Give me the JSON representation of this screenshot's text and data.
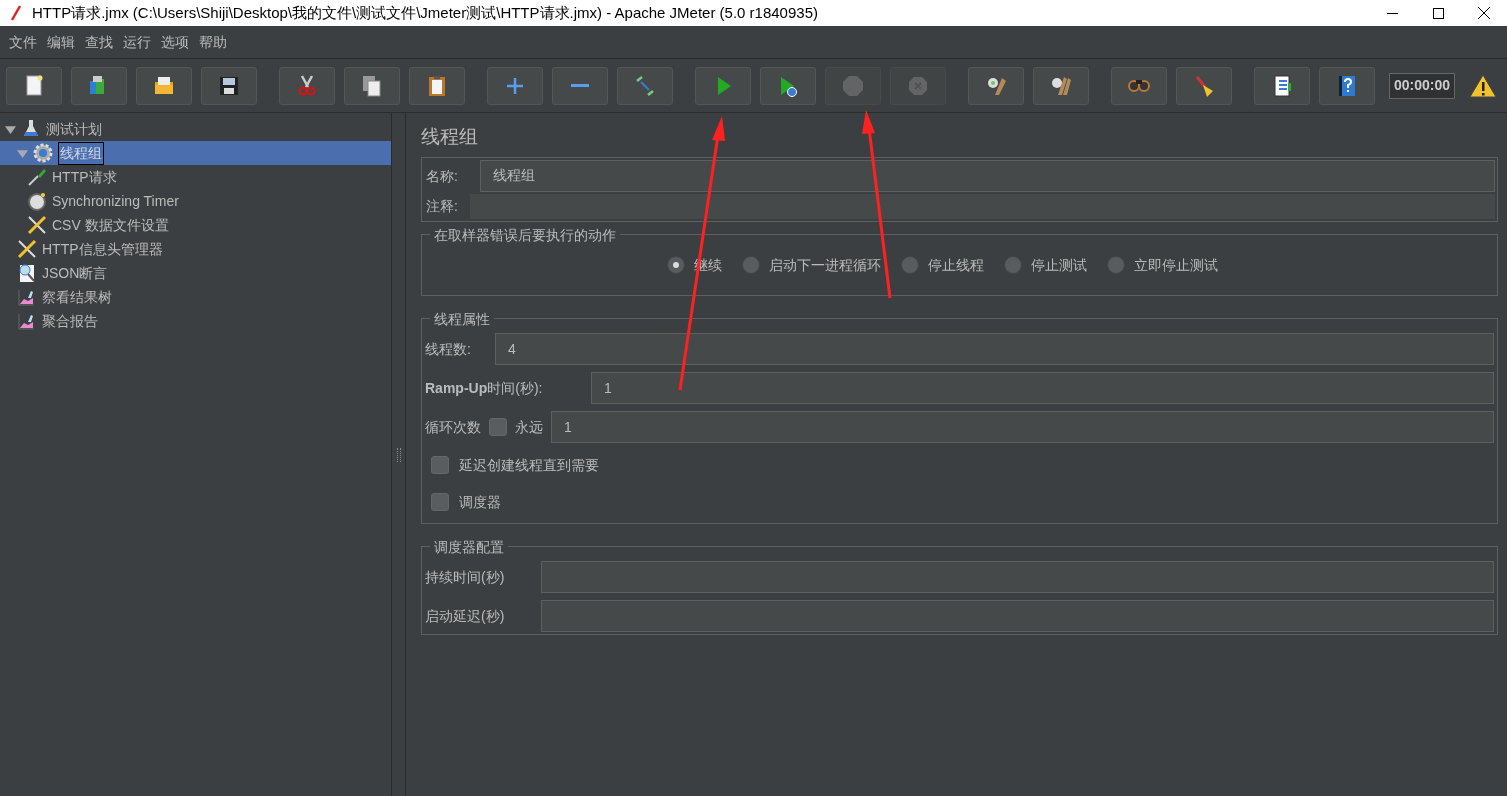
{
  "window": {
    "title": "HTTP请求.jmx (C:\\Users\\Shiji\\Desktop\\我的文件\\测试文件\\Jmeter测试\\HTTP请求.jmx) - Apache JMeter (5.0 r1840935)"
  },
  "menu": [
    "文件",
    "编辑",
    "查找",
    "运行",
    "选项",
    "帮助"
  ],
  "toolbar": [
    [
      {
        "kind": "new",
        "disabled": false
      },
      {
        "kind": "templates",
        "disabled": false
      },
      {
        "kind": "open",
        "disabled": false
      },
      {
        "kind": "save",
        "disabled": false
      }
    ],
    [
      {
        "kind": "cut",
        "disabled": false
      },
      {
        "kind": "copy",
        "disabled": false
      },
      {
        "kind": "paste",
        "disabled": false
      }
    ],
    [
      {
        "kind": "expand",
        "disabled": false
      },
      {
        "kind": "collapse",
        "disabled": false
      },
      {
        "kind": "toggle",
        "disabled": false
      }
    ],
    [
      {
        "kind": "start",
        "disabled": false
      },
      {
        "kind": "start-no-pause",
        "disabled": false
      },
      {
        "kind": "stop",
        "disabled": true
      },
      {
        "kind": "shutdown",
        "disabled": true
      }
    ],
    [
      {
        "kind": "clear",
        "disabled": false
      },
      {
        "kind": "clear-all",
        "disabled": false
      }
    ],
    [
      {
        "kind": "search",
        "disabled": false
      },
      {
        "kind": "reset",
        "disabled": false
      }
    ],
    [
      {
        "kind": "functions",
        "disabled": false
      },
      {
        "kind": "help",
        "disabled": false
      }
    ]
  ],
  "timer": "00:00:00",
  "tree": [
    {
      "label": "测试计划",
      "kind": "plan",
      "expanded": true,
      "selected": false,
      "children": [
        {
          "label": "线程组",
          "kind": "threadgroup",
          "expanded": true,
          "selected": true,
          "children": [
            {
              "label": "HTTP请求",
              "kind": "sampler",
              "selected": false
            },
            {
              "label": "Synchronizing Timer",
              "kind": "timer",
              "selected": false
            },
            {
              "label": "CSV 数据文件设置",
              "kind": "config",
              "selected": false
            }
          ]
        },
        {
          "label": "HTTP信息头管理器",
          "kind": "config",
          "selected": false
        },
        {
          "label": "JSON断言",
          "kind": "assertion",
          "selected": false
        },
        {
          "label": "察看结果树",
          "kind": "listener",
          "selected": false
        },
        {
          "label": "聚合报告",
          "kind": "listener",
          "selected": false
        }
      ]
    }
  ],
  "panel": {
    "title": "线程组",
    "name": {
      "label": "名称:",
      "value": "线程组"
    },
    "comment": {
      "label": "注释:"
    },
    "on_error": {
      "legend": "在取样器错误后要执行的动作",
      "options": [
        {
          "label": "继续",
          "selected": true
        },
        {
          "label": "启动下一进程循环",
          "selected": false
        },
        {
          "label": "停止线程",
          "selected": false
        },
        {
          "label": "停止测试",
          "selected": false
        },
        {
          "label": "立即停止测试",
          "selected": false
        }
      ]
    },
    "thread_props": {
      "legend": "线程属性",
      "threads": {
        "label": "线程数:",
        "value": "4"
      },
      "rampup": {
        "label": "**Ramp-Up**时间(秒):",
        "value": "1"
      },
      "loops": {
        "label": "循环次数",
        "forever": {
          "label": "永远",
          "checked": false
        },
        "value": "1"
      },
      "delay": {
        "label": "延迟创建线程直到需要",
        "checked": false
      },
      "scheduler": {
        "label": "调度器",
        "checked": false
      }
    },
    "scheduler_config": {
      "legend": "调度器配置",
      "duration": {
        "label": "持续时间(秒)"
      },
      "startup_delay": {
        "label": "启动延迟(秒)"
      }
    }
  }
}
